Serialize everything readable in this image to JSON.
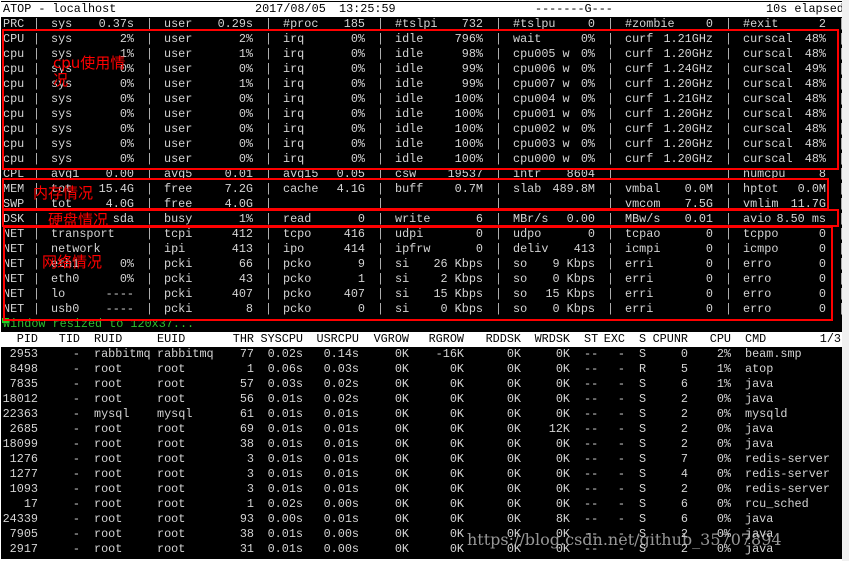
{
  "title_bar": {
    "app": "ATOP - localhost",
    "date": "2017/08/05",
    "time": "13:25:59",
    "flags": "-------G---",
    "elapsed": "10s elapsed"
  },
  "system_rows": [
    {
      "label": "PRC",
      "fields": [
        [
          "sys",
          "0.37s"
        ],
        [
          "user",
          "0.29s"
        ],
        [
          "#proc",
          "185"
        ],
        [
          "#tslpi",
          "732"
        ],
        [
          "#tslpu",
          "0"
        ],
        [
          "#zombie",
          "0"
        ],
        [
          "#exit",
          "2"
        ]
      ]
    },
    {
      "label": "CPU",
      "fields": [
        [
          "sys",
          "2%"
        ],
        [
          "user",
          "2%"
        ],
        [
          "irq",
          "0%"
        ],
        [
          "idle",
          "796%"
        ],
        [
          "wait",
          "0%"
        ],
        [
          "curf",
          "1.21GHz"
        ],
        [
          "curscal",
          "48%"
        ]
      ]
    },
    {
      "label": "cpu",
      "fields": [
        [
          "sys",
          "1%"
        ],
        [
          "user",
          "1%"
        ],
        [
          "irq",
          "0%"
        ],
        [
          "idle",
          "98%"
        ],
        [
          "cpu005 w",
          "0%"
        ],
        [
          "curf",
          "1.20GHz"
        ],
        [
          "curscal",
          "48%"
        ]
      ]
    },
    {
      "label": "cpu",
      "fields": [
        [
          "sys",
          "0%"
        ],
        [
          "user",
          "0%"
        ],
        [
          "irq",
          "0%"
        ],
        [
          "idle",
          "99%"
        ],
        [
          "cpu006 w",
          "0%"
        ],
        [
          "curf",
          "1.24GHz"
        ],
        [
          "curscal",
          "49%"
        ]
      ]
    },
    {
      "label": "cpu",
      "fields": [
        [
          "sys",
          "0%"
        ],
        [
          "user",
          "1%"
        ],
        [
          "irq",
          "0%"
        ],
        [
          "idle",
          "99%"
        ],
        [
          "cpu007 w",
          "0%"
        ],
        [
          "curf",
          "1.20GHz"
        ],
        [
          "curscal",
          "48%"
        ]
      ]
    },
    {
      "label": "cpu",
      "fields": [
        [
          "sys",
          "0%"
        ],
        [
          "user",
          "0%"
        ],
        [
          "irq",
          "0%"
        ],
        [
          "idle",
          "100%"
        ],
        [
          "cpu004 w",
          "0%"
        ],
        [
          "curf",
          "1.21GHz"
        ],
        [
          "curscal",
          "48%"
        ]
      ]
    },
    {
      "label": "cpu",
      "fields": [
        [
          "sys",
          "0%"
        ],
        [
          "user",
          "0%"
        ],
        [
          "irq",
          "0%"
        ],
        [
          "idle",
          "100%"
        ],
        [
          "cpu001 w",
          "0%"
        ],
        [
          "curf",
          "1.20GHz"
        ],
        [
          "curscal",
          "48%"
        ]
      ]
    },
    {
      "label": "cpu",
      "fields": [
        [
          "sys",
          "0%"
        ],
        [
          "user",
          "0%"
        ],
        [
          "irq",
          "0%"
        ],
        [
          "idle",
          "100%"
        ],
        [
          "cpu002 w",
          "0%"
        ],
        [
          "curf",
          "1.20GHz"
        ],
        [
          "curscal",
          "48%"
        ]
      ]
    },
    {
      "label": "cpu",
      "fields": [
        [
          "sys",
          "0%"
        ],
        [
          "user",
          "0%"
        ],
        [
          "irq",
          "0%"
        ],
        [
          "idle",
          "100%"
        ],
        [
          "cpu003 w",
          "0%"
        ],
        [
          "curf",
          "1.20GHz"
        ],
        [
          "curscal",
          "48%"
        ]
      ]
    },
    {
      "label": "cpu",
      "fields": [
        [
          "sys",
          "0%"
        ],
        [
          "user",
          "0%"
        ],
        [
          "irq",
          "0%"
        ],
        [
          "idle",
          "100%"
        ],
        [
          "cpu000 w",
          "0%"
        ],
        [
          "curf",
          "1.20GHz"
        ],
        [
          "curscal",
          "48%"
        ]
      ]
    },
    {
      "label": "CPL",
      "fields": [
        [
          "avg1",
          "0.00"
        ],
        [
          "avg5",
          "0.01"
        ],
        [
          "avg15",
          "0.05"
        ],
        [
          "csw",
          "19537"
        ],
        [
          "intr",
          "8604"
        ],
        [
          "",
          ""
        ],
        [
          "numcpu",
          "8"
        ]
      ]
    },
    {
      "label": "MEM",
      "fields": [
        [
          "tot",
          "15.4G"
        ],
        [
          "free",
          "7.2G"
        ],
        [
          "cache",
          "4.1G"
        ],
        [
          "buff",
          "0.7M"
        ],
        [
          "slab",
          "489.8M"
        ],
        [
          "vmbal",
          "0.0M"
        ],
        [
          "hptot",
          "0.0M"
        ]
      ]
    },
    {
      "label": "SWP",
      "fields": [
        [
          "tot",
          "4.0G"
        ],
        [
          "free",
          "4.0G"
        ],
        [
          "",
          ""
        ],
        [
          "",
          ""
        ],
        [
          "",
          ""
        ],
        [
          "vmcom",
          "7.5G"
        ],
        [
          "vmlim",
          "11.7G"
        ]
      ]
    },
    {
      "label": "DSK",
      "fields": [
        [
          "",
          "sda"
        ],
        [
          "busy",
          "1%"
        ],
        [
          "read",
          "0"
        ],
        [
          "write",
          "6"
        ],
        [
          "MBr/s",
          "0.00"
        ],
        [
          "MBw/s",
          "0.01"
        ],
        [
          "avio",
          "8.50 ms"
        ]
      ]
    },
    {
      "label": "NET",
      "fields": [
        [
          "transport",
          ""
        ],
        [
          "tcpi",
          "412"
        ],
        [
          "tcpo",
          "416"
        ],
        [
          "udpi",
          "0"
        ],
        [
          "udpo",
          "0"
        ],
        [
          "tcpao",
          "0"
        ],
        [
          "tcppo",
          "0"
        ]
      ]
    },
    {
      "label": "NET",
      "fields": [
        [
          "network",
          ""
        ],
        [
          "ipi",
          "413"
        ],
        [
          "ipo",
          "414"
        ],
        [
          "ipfrw",
          "0"
        ],
        [
          "deliv",
          "413"
        ],
        [
          "icmpi",
          "0"
        ],
        [
          "icmpo",
          "0"
        ]
      ]
    },
    {
      "label": "NET",
      "fields": [
        [
          "eth1",
          "0%"
        ],
        [
          "pcki",
          "66"
        ],
        [
          "pcko",
          "9"
        ],
        [
          "si",
          "26 Kbps"
        ],
        [
          "so",
          "9 Kbps"
        ],
        [
          "erri",
          "0"
        ],
        [
          "erro",
          "0"
        ]
      ]
    },
    {
      "label": "NET",
      "fields": [
        [
          "eth0",
          "0%"
        ],
        [
          "pcki",
          "43"
        ],
        [
          "pcko",
          "1"
        ],
        [
          "si",
          "2 Kbps"
        ],
        [
          "so",
          "0 Kbps"
        ],
        [
          "erri",
          "0"
        ],
        [
          "erro",
          "0"
        ]
      ]
    },
    {
      "label": "NET",
      "fields": [
        [
          "lo",
          "----"
        ],
        [
          "pcki",
          "407"
        ],
        [
          "pcko",
          "407"
        ],
        [
          "si",
          "15 Kbps"
        ],
        [
          "so",
          "15 Kbps"
        ],
        [
          "erri",
          "0"
        ],
        [
          "erro",
          "0"
        ]
      ]
    },
    {
      "label": "NET",
      "fields": [
        [
          "usb0",
          "----"
        ],
        [
          "pcki",
          "8"
        ],
        [
          "pcko",
          "0"
        ],
        [
          "si",
          "0 Kbps"
        ],
        [
          "so",
          "0 Kbps"
        ],
        [
          "erri",
          "0"
        ],
        [
          "erro",
          "0"
        ]
      ]
    }
  ],
  "status_message": "Window resized to 120x37...",
  "process_table": {
    "columns": [
      "PID",
      "TID",
      "RUID",
      "EUID",
      "THR",
      "SYSCPU",
      "USRCPU",
      "VGROW",
      "RGROW",
      "RDDSK",
      "WRDSK",
      "ST",
      "EXC",
      "S",
      "CPUNR",
      "CPU",
      "CMD"
    ],
    "page": "1/3",
    "rows": [
      [
        "2953",
        "-",
        "rabbitmq",
        "rabbitmq",
        "77",
        "0.02s",
        "0.14s",
        "0K",
        "-16K",
        "0K",
        "0K",
        "--",
        "-",
        "S",
        "0",
        "2%",
        "beam.smp"
      ],
      [
        "8498",
        "-",
        "root",
        "root",
        "1",
        "0.06s",
        "0.03s",
        "0K",
        "0K",
        "0K",
        "0K",
        "--",
        "-",
        "R",
        "5",
        "1%",
        "atop"
      ],
      [
        "7835",
        "-",
        "root",
        "root",
        "57",
        "0.03s",
        "0.02s",
        "0K",
        "0K",
        "0K",
        "0K",
        "--",
        "-",
        "S",
        "6",
        "1%",
        "java"
      ],
      [
        "18012",
        "-",
        "root",
        "root",
        "56",
        "0.01s",
        "0.02s",
        "0K",
        "0K",
        "0K",
        "0K",
        "--",
        "-",
        "S",
        "2",
        "0%",
        "java"
      ],
      [
        "22363",
        "-",
        "mysql",
        "mysql",
        "61",
        "0.01s",
        "0.01s",
        "0K",
        "0K",
        "0K",
        "0K",
        "--",
        "-",
        "S",
        "2",
        "0%",
        "mysqld"
      ],
      [
        "2685",
        "-",
        "root",
        "root",
        "69",
        "0.01s",
        "0.01s",
        "0K",
        "0K",
        "0K",
        "12K",
        "--",
        "-",
        "S",
        "2",
        "0%",
        "java"
      ],
      [
        "18099",
        "-",
        "root",
        "root",
        "38",
        "0.01s",
        "0.01s",
        "0K",
        "0K",
        "0K",
        "0K",
        "--",
        "-",
        "S",
        "2",
        "0%",
        "java"
      ],
      [
        "1276",
        "-",
        "root",
        "root",
        "3",
        "0.01s",
        "0.01s",
        "0K",
        "0K",
        "0K",
        "0K",
        "--",
        "-",
        "S",
        "7",
        "0%",
        "redis-server"
      ],
      [
        "1277",
        "-",
        "root",
        "root",
        "3",
        "0.01s",
        "0.01s",
        "0K",
        "0K",
        "0K",
        "0K",
        "--",
        "-",
        "S",
        "4",
        "0%",
        "redis-server"
      ],
      [
        "1093",
        "-",
        "root",
        "root",
        "3",
        "0.01s",
        "0.01s",
        "0K",
        "0K",
        "0K",
        "0K",
        "--",
        "-",
        "S",
        "2",
        "0%",
        "redis-server"
      ],
      [
        "17",
        "-",
        "root",
        "root",
        "1",
        "0.02s",
        "0.00s",
        "0K",
        "0K",
        "0K",
        "0K",
        "--",
        "-",
        "S",
        "6",
        "0%",
        "rcu_sched"
      ],
      [
        "24339",
        "-",
        "root",
        "root",
        "93",
        "0.00s",
        "0.01s",
        "0K",
        "0K",
        "0K",
        "8K",
        "--",
        "-",
        "S",
        "6",
        "0%",
        "java"
      ],
      [
        "7905",
        "-",
        "root",
        "root",
        "38",
        "0.01s",
        "0.00s",
        "0K",
        "0K",
        "0K",
        "0K",
        "--",
        "-",
        "S",
        "2",
        "0%",
        "java"
      ],
      [
        "2917",
        "-",
        "root",
        "root",
        "31",
        "0.01s",
        "0.00s",
        "0K",
        "0K",
        "0K",
        "0K",
        "--",
        "-",
        "S",
        "2",
        "0%",
        "java"
      ]
    ]
  },
  "annotations": {
    "cpu": "cpu使用情况",
    "memory": "内存情况",
    "disk": "硬盘情况",
    "network": "网络情况",
    "color": "#ff0000"
  },
  "watermark": "https://blog.csdn.net/github_35707894"
}
